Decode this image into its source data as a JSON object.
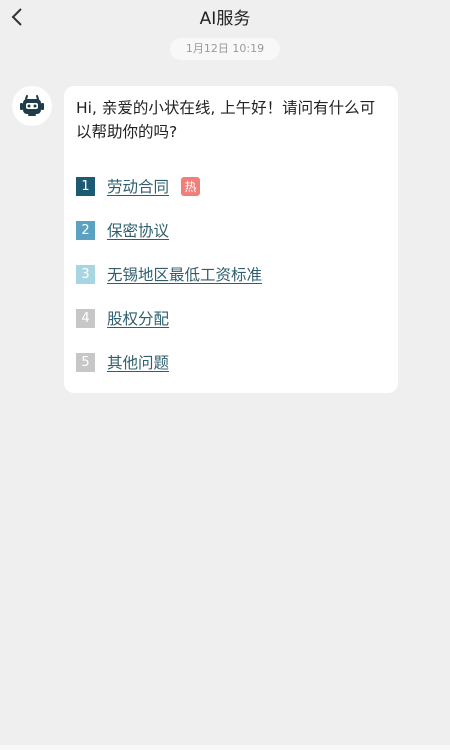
{
  "header": {
    "title": "AI服务",
    "back_icon": "chevron-left-icon"
  },
  "timestamp": "1月12日 10:19",
  "bot": {
    "avatar_icon": "robot-icon",
    "greeting": "Hi, 亲爱的小状在线, 上午好！请问有什么可以帮助你的吗?"
  },
  "menu": {
    "items": [
      {
        "num": "1",
        "label": "劳动合同",
        "color": "#1c5a73",
        "badge": "热"
      },
      {
        "num": "2",
        "label": "保密协议",
        "color": "#5aa2bf"
      },
      {
        "num": "3",
        "label": "无锡地区最低工资标准",
        "color": "#a8d5e2"
      },
      {
        "num": "4",
        "label": "股权分配",
        "color": "#c7c7c7"
      },
      {
        "num": "5",
        "label": "其他问题",
        "color": "#c7c7c7"
      }
    ]
  },
  "colors": {
    "background": "#efefef",
    "link": "#2f5f6e",
    "hot_badge": "#f07e79"
  }
}
